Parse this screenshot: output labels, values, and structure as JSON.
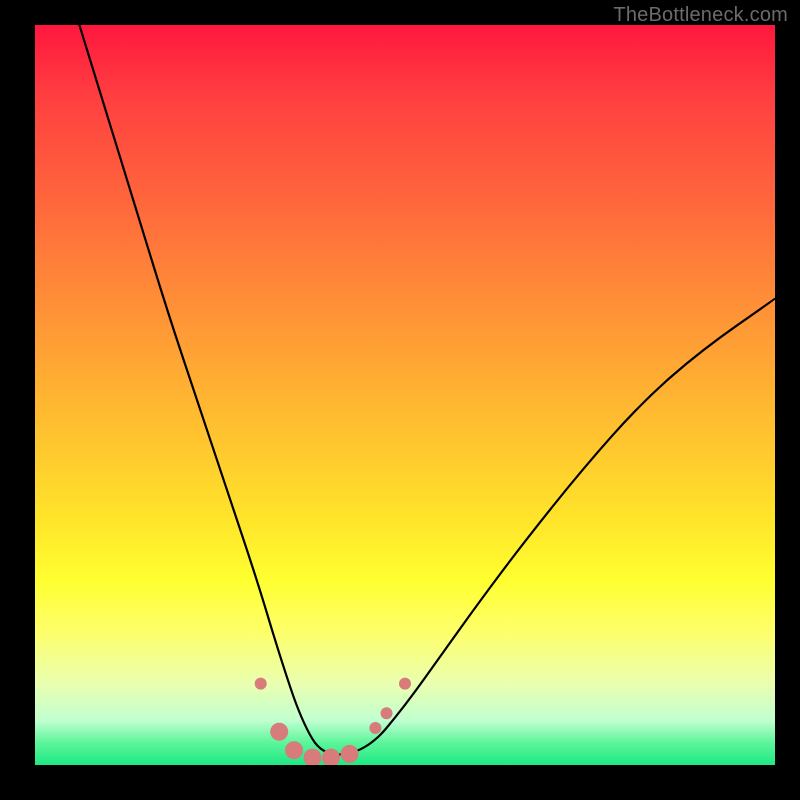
{
  "watermark": "TheBottleneck.com",
  "chart_data": {
    "type": "line",
    "title": "",
    "xlabel": "",
    "ylabel": "",
    "xlim": [
      0,
      100
    ],
    "ylim": [
      0,
      100
    ],
    "gradient_stops": [
      {
        "pos": 0,
        "color": "#ff173e"
      },
      {
        "pos": 10,
        "color": "#ff4040"
      },
      {
        "pos": 25,
        "color": "#ff6a3c"
      },
      {
        "pos": 40,
        "color": "#ff9636"
      },
      {
        "pos": 54,
        "color": "#ffbf30"
      },
      {
        "pos": 67,
        "color": "#ffe52a"
      },
      {
        "pos": 75,
        "color": "#ffff30"
      },
      {
        "pos": 82,
        "color": "#fdff6a"
      },
      {
        "pos": 89,
        "color": "#eaffb0"
      },
      {
        "pos": 94,
        "color": "#c0ffd0"
      },
      {
        "pos": 97,
        "color": "#5cf59a"
      },
      {
        "pos": 100,
        "color": "#1ee884"
      }
    ],
    "series": [
      {
        "name": "bottleneck-curve",
        "color": "#000000",
        "x": [
          6,
          10,
          14,
          18,
          22,
          26,
          30,
          33,
          36,
          39,
          45,
          50,
          55,
          60,
          66,
          74,
          82,
          90,
          100
        ],
        "values": [
          100,
          87,
          74,
          61,
          49,
          37,
          25,
          15,
          6,
          1,
          2,
          8,
          15,
          22,
          30,
          40,
          49,
          56,
          63
        ]
      }
    ],
    "markers": {
      "name": "highlight-dots",
      "color": "#d77b7b",
      "radius_small": 6,
      "radius_large": 9,
      "points": [
        {
          "x": 30.5,
          "y": 11,
          "r": "small"
        },
        {
          "x": 33.0,
          "y": 4.5,
          "r": "large"
        },
        {
          "x": 35.0,
          "y": 2.0,
          "r": "large"
        },
        {
          "x": 37.5,
          "y": 1.0,
          "r": "large"
        },
        {
          "x": 40.0,
          "y": 1.0,
          "r": "large"
        },
        {
          "x": 42.5,
          "y": 1.5,
          "r": "large"
        },
        {
          "x": 46.0,
          "y": 5.0,
          "r": "small"
        },
        {
          "x": 47.5,
          "y": 7.0,
          "r": "small"
        },
        {
          "x": 50.0,
          "y": 11.0,
          "r": "small"
        }
      ]
    }
  }
}
